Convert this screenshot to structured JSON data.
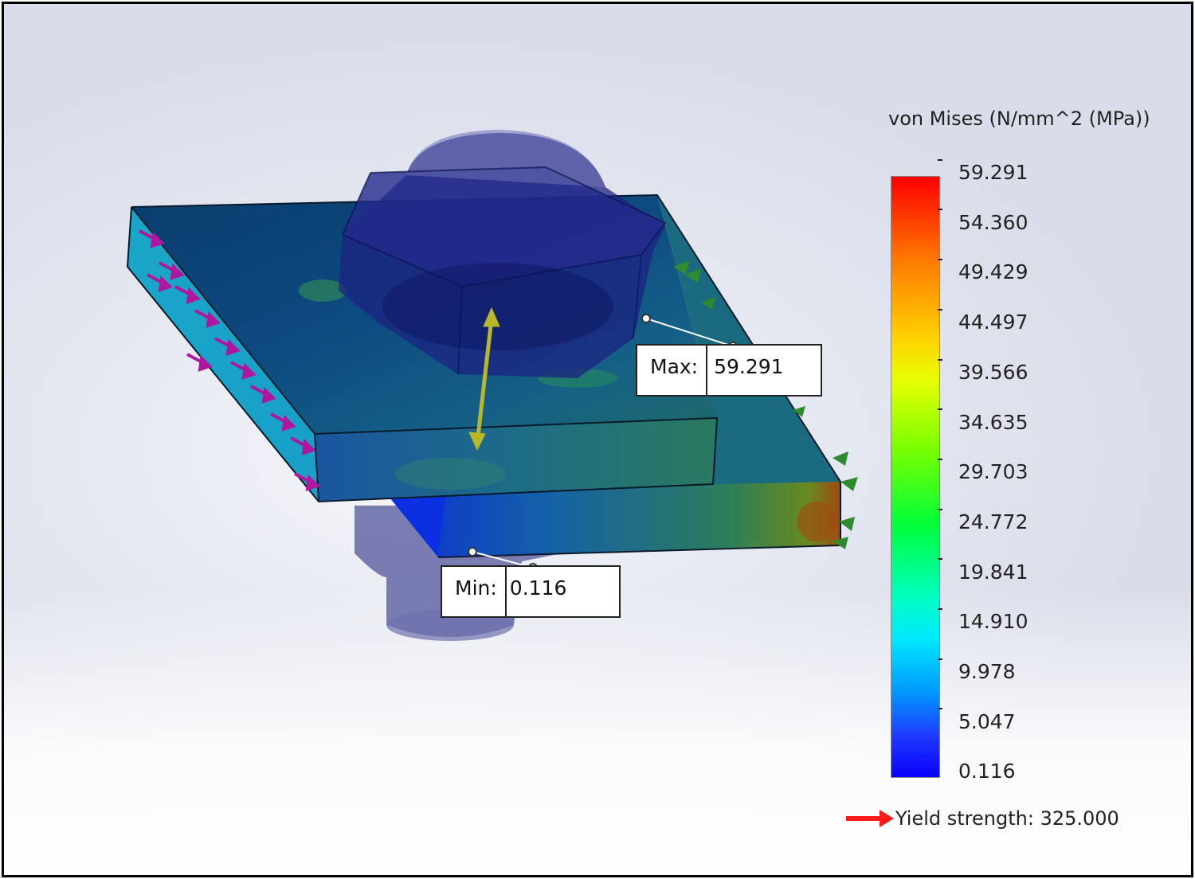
{
  "legend": {
    "title": "von Mises (N/mm^2 (MPa))",
    "values": [
      "59.291",
      "54.360",
      "49.429",
      "44.497",
      "39.566",
      "34.635",
      "29.703",
      "24.772",
      "19.841",
      "14.910",
      "9.978",
      "5.047",
      "0.116"
    ]
  },
  "max_callout": {
    "key": "Max:",
    "value": "59.291"
  },
  "min_callout": {
    "key": "Min:",
    "value": "0.116"
  },
  "yield": {
    "label": "Yield strength: 325.000",
    "arrow_color": "#ff1a1a"
  },
  "colors": {
    "max": "#ff0000",
    "min": "#0a00ff",
    "load_arrows": "#b0169e",
    "fixtures": "#2e8b2e"
  }
}
